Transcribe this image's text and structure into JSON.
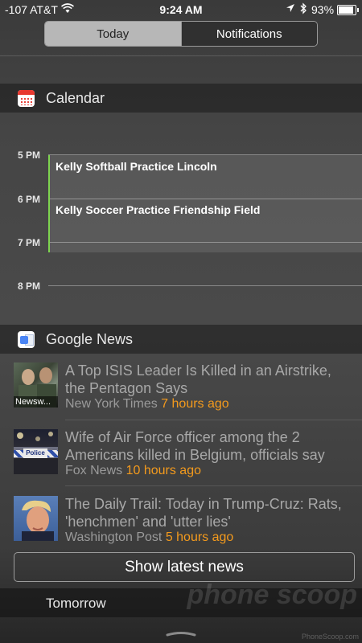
{
  "status_bar": {
    "carrier": "-107 AT&T",
    "time": "9:24 AM",
    "battery": "93%"
  },
  "tabs": [
    {
      "label": "Today",
      "active": true
    },
    {
      "label": "Notifications",
      "active": false
    }
  ],
  "calendar": {
    "title": "Calendar",
    "hours": [
      "5 PM",
      "6 PM",
      "7 PM",
      "8 PM"
    ],
    "events": [
      {
        "title": "Kelly Softball Practice Lincoln"
      },
      {
        "title": "Kelly Soccer Practice Friendship Field"
      }
    ],
    "accent_color": "#7ed44f"
  },
  "google_news": {
    "title": "Google News",
    "items": [
      {
        "headline": "A Top ISIS Leader Is Killed in an Airstrike, the Pentagon Says",
        "source": "New York Times",
        "ago": "7 hours ago",
        "thumb_caption": "Newsw..."
      },
      {
        "headline": "Wife of Air Force officer among the 2 Americans killed in Belgium, officials say",
        "source": "Fox News",
        "ago": "10 hours ago",
        "thumb_caption": "Police"
      },
      {
        "headline": "The Daily Trail: Today in Trump-Cruz: Rats, 'henchmen' and 'utter lies'",
        "source": "Washington Post",
        "ago": "5 hours ago"
      }
    ],
    "show_more": "Show latest news",
    "time_color": "#f39a1d"
  },
  "tomorrow": {
    "title": "Tomorrow"
  },
  "watermark": {
    "text": "phone scoop",
    "sub": "PhoneScoop.com"
  }
}
